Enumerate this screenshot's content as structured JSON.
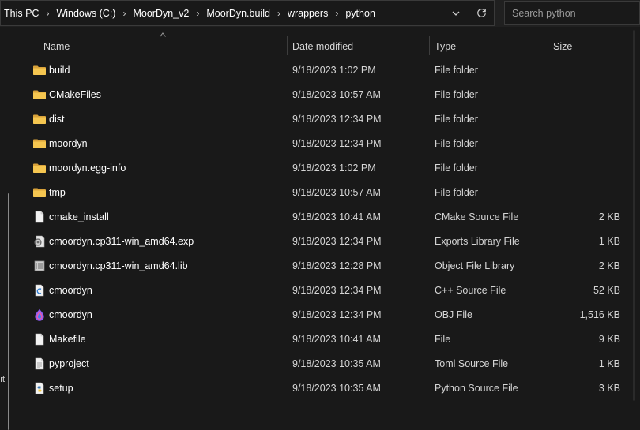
{
  "breadcrumb": [
    "This PC",
    "Windows (C:)",
    "MoorDyn_v2",
    "MoorDyn.build",
    "wrappers",
    "python"
  ],
  "search": {
    "placeholder": "Search python"
  },
  "columns": {
    "name": "Name",
    "date": "Date modified",
    "type": "Type",
    "size": "Size"
  },
  "nav_fragment": "ıt",
  "colors": {
    "background": "#191919",
    "folder": "#e8b84a",
    "text": "#ffffff",
    "muted": "#d5d5d5"
  },
  "files": [
    {
      "name": "build",
      "date": "9/18/2023 1:02 PM",
      "type": "File folder",
      "size": "",
      "icon": "folder-icon"
    },
    {
      "name": "CMakeFiles",
      "date": "9/18/2023 10:57 AM",
      "type": "File folder",
      "size": "",
      "icon": "folder-icon"
    },
    {
      "name": "dist",
      "date": "9/18/2023 12:34 PM",
      "type": "File folder",
      "size": "",
      "icon": "folder-icon"
    },
    {
      "name": "moordyn",
      "date": "9/18/2023 12:34 PM",
      "type": "File folder",
      "size": "",
      "icon": "folder-icon"
    },
    {
      "name": "moordyn.egg-info",
      "date": "9/18/2023 1:02 PM",
      "type": "File folder",
      "size": "",
      "icon": "folder-icon"
    },
    {
      "name": "tmp",
      "date": "9/18/2023 10:57 AM",
      "type": "File folder",
      "size": "",
      "icon": "folder-icon"
    },
    {
      "name": "cmake_install",
      "date": "9/18/2023 10:41 AM",
      "type": "CMake Source File",
      "size": "2 KB",
      "icon": "document-icon"
    },
    {
      "name": "cmoordyn.cp311-win_amd64.exp",
      "date": "9/18/2023 12:34 PM",
      "type": "Exports Library File",
      "size": "1 KB",
      "icon": "gear-file-icon"
    },
    {
      "name": "cmoordyn.cp311-win_amd64.lib",
      "date": "9/18/2023 12:28 PM",
      "type": "Object File Library",
      "size": "2 KB",
      "icon": "library-file-icon"
    },
    {
      "name": "cmoordyn",
      "date": "9/18/2023 12:34 PM",
      "type": "C++ Source File",
      "size": "52 KB",
      "icon": "cpp-file-icon"
    },
    {
      "name": "cmoordyn",
      "date": "9/18/2023 12:34 PM",
      "type": "OBJ File",
      "size": "1,516 KB",
      "icon": "obj-file-icon"
    },
    {
      "name": "Makefile",
      "date": "9/18/2023 10:41 AM",
      "type": "File",
      "size": "9 KB",
      "icon": "document-icon"
    },
    {
      "name": "pyproject",
      "date": "9/18/2023 10:35 AM",
      "type": "Toml Source File",
      "size": "1 KB",
      "icon": "document-lines-icon"
    },
    {
      "name": "setup",
      "date": "9/18/2023 10:35 AM",
      "type": "Python Source File",
      "size": "3 KB",
      "icon": "python-file-icon"
    }
  ]
}
